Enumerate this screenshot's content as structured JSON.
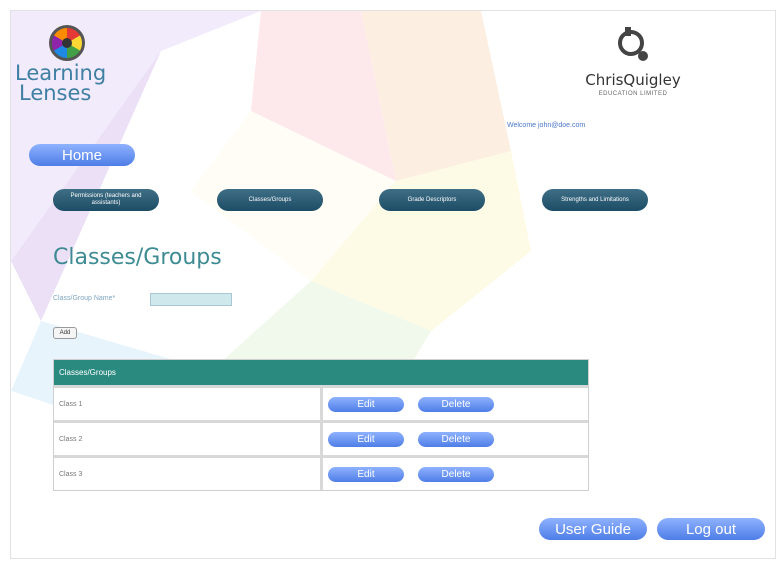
{
  "brand": {
    "left_logo_line1": "Learning",
    "left_logo_line2": "Lenses",
    "right_logo_name": "ChrisQuigley",
    "right_logo_sub": "EDUCATION LIMITED"
  },
  "welcome_text": "Welcome john@doe.com",
  "home_label": "Home",
  "nav": [
    {
      "label": "Permissions (teachers and assistants)"
    },
    {
      "label": "Classes/Groups"
    },
    {
      "label": "Grade Descriptors"
    },
    {
      "label": "Strengths and Limitations"
    }
  ],
  "page_title": "Classes/Groups",
  "form": {
    "label": "Class/Group Name*",
    "value": "",
    "add_label": "Add"
  },
  "table": {
    "header": "Classes/Groups",
    "rows": [
      {
        "name": "Class 1",
        "edit": "Edit",
        "delete": "Delete"
      },
      {
        "name": "Class 2",
        "edit": "Edit",
        "delete": "Delete"
      },
      {
        "name": "Class 3",
        "edit": "Edit",
        "delete": "Delete"
      }
    ]
  },
  "footer": {
    "guide_label": "User Guide",
    "logout_label": "Log out"
  },
  "colors": {
    "accent_blue": "#5a86ee",
    "nav_dark": "#1d4c66",
    "table_header": "#2b8a80",
    "title_teal": "#3e8b93"
  }
}
